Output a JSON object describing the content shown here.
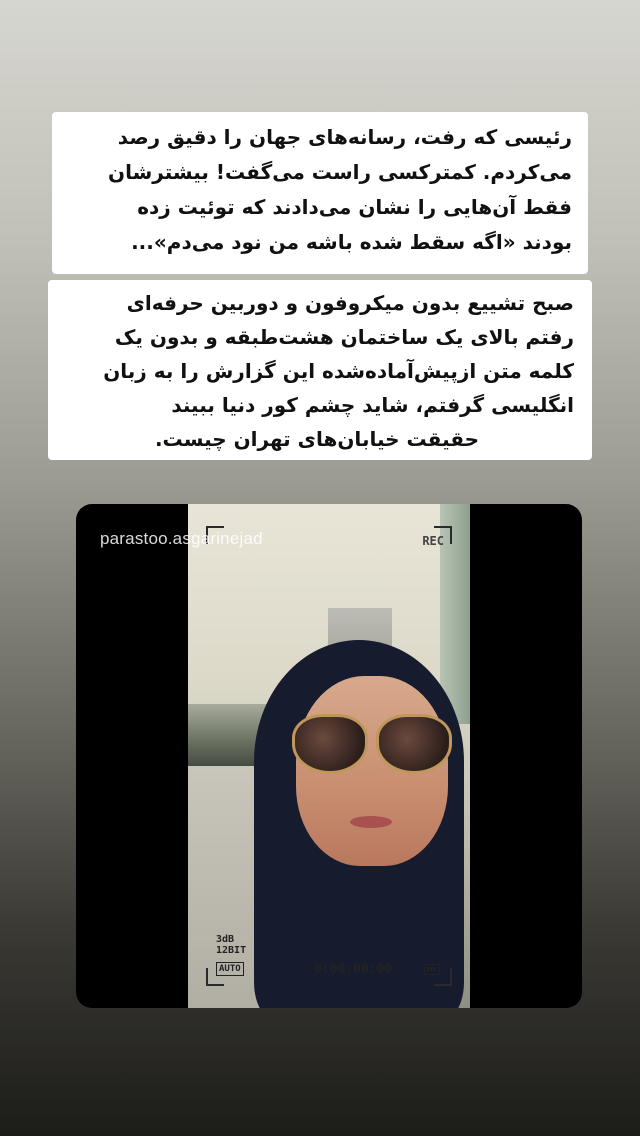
{
  "captions": {
    "first": [
      "رئیسی که رفت، رسانه‌های جهان را دقیق رصد",
      "می‌کردم. کمترکسی راست می‌گفت! بیشترشان",
      "فقط آن‌هایی را نشان می‌دادند که توئیت زده",
      "بودند «اگه سقط شده باشه من نود می‌دم»..."
    ],
    "second": [
      "صبح تشییع بدون میکروفون و دوربین حرفه‌ای",
      "رفتم بالای یک ساختمان هشت‌طبقه و بدون یک",
      "کلمه متن ازپیش‌آماده‌شده این گزارش را به زبان",
      "انگلیسی گرفتم، شاید چشم کور دنیا ببیند",
      "حقیقت خیابان‌های تهران چیست."
    ]
  },
  "video": {
    "username_watermark": "parastoo.asgarinejad",
    "rec_label": "REC",
    "audio_level": "3dB",
    "bit_depth": "12BIT",
    "mode_badge": "AUTO",
    "timecode": "0:00:00:00",
    "battery_icon": "battery-icon"
  }
}
